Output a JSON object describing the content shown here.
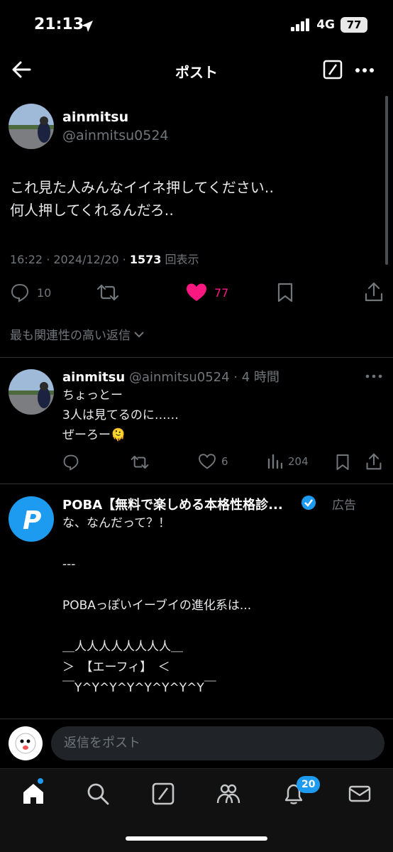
{
  "status_bar": {
    "time": "21:13",
    "network": "4G",
    "battery": "77"
  },
  "header": {
    "title": "ポスト"
  },
  "post": {
    "name": "ainmitsu",
    "handle": "@ainmitsu0524",
    "text": "これ見た人みんなイイネ押してください‥\n何人押してくれるんだろ‥",
    "time": "16:22 · 2024/12/20 · ",
    "views": "1573",
    "views_label": "回表示",
    "replies": "10",
    "likes": "77",
    "sort_label": "最も関連性の高い返信"
  },
  "reply": {
    "name": "ainmitsu",
    "handle": "@ainmitsu0524",
    "time": "· 4 時間",
    "text": "ちょっとー\n3人は見てるのに‥‥‥\nぜーろー🫠",
    "likes": "6",
    "views": "204"
  },
  "ad": {
    "name": "POBA【無料で楽しめる本格性格診...",
    "label": "広告",
    "text": "な、なんだって？！\n\n---\n\nPOBAっぽいイーブイの進化系は...\n\n＿人人人人人人人人＿\n＞　【エーフィ】　＜\n￣Y^Y^Y^Y^Y^Y^Y^Y￣\n\n📻 神秘的な予言者"
  },
  "reply_bar": {
    "placeholder": "返信をポスト"
  },
  "tabbar": {
    "notifications_count": "20"
  },
  "colors": {
    "like": "#f91880",
    "accent": "#1d9bf0"
  }
}
